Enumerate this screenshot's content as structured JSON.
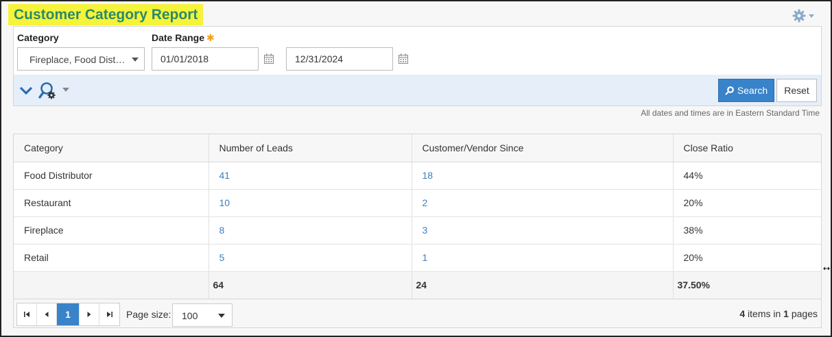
{
  "page": {
    "title": "Customer Category Report"
  },
  "icons": {
    "settings": "gear-icon",
    "expand": "chevron-down-icon",
    "advanced_search": "search-settings-icon",
    "calendar": "calendar-icon"
  },
  "colors": {
    "accent": "#3883c9",
    "link": "#3a7fc1",
    "title_highlight": "#f5f33a",
    "title_text": "#2a8a6a",
    "required": "#f0a020"
  },
  "filters": {
    "category": {
      "label": "Category",
      "value": "Fireplace, Food Distributor"
    },
    "date_range": {
      "label": "Date Range",
      "required_mark": "✱",
      "start": "01/01/2018",
      "end": "12/31/2024"
    },
    "search_label": "Search",
    "reset_label": "Reset"
  },
  "timezone_note": "All dates and times are in Eastern Standard Time",
  "table": {
    "columns": [
      "Category",
      "Number of Leads",
      "Customer/Vendor Since",
      "Close Ratio"
    ],
    "rows": [
      {
        "category": "Food Distributor",
        "leads": "41",
        "since": "18",
        "ratio": "44%"
      },
      {
        "category": "Restaurant",
        "leads": "10",
        "since": "2",
        "ratio": "20%"
      },
      {
        "category": "Fireplace",
        "leads": "8",
        "since": "3",
        "ratio": "38%"
      },
      {
        "category": "Retail",
        "leads": "5",
        "since": "1",
        "ratio": "20%"
      }
    ],
    "totals": {
      "category": "",
      "leads": "64",
      "since": "24",
      "ratio": "37.50%"
    }
  },
  "pager": {
    "current_page": "1",
    "page_size_label": "Page size:",
    "page_size": "100",
    "items": "4",
    "items_text": "items in",
    "pages": "1",
    "pages_text": "pages"
  }
}
